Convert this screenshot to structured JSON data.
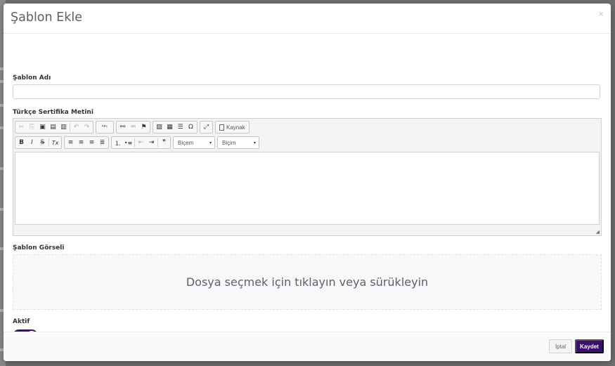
{
  "modal": {
    "title": "Şablon Ekle",
    "close_symbol": "×"
  },
  "fields": {
    "template_name_label": "Şablon Adı",
    "template_name_value": "",
    "certificate_text_label": "Türkçe Sertifika Metini",
    "template_image_label": "Şablon Görseli",
    "dropzone_text": "Dosya seçmek için tıklayın veya sürükleyin",
    "active_label": "Aktif",
    "active": true
  },
  "editor": {
    "source_label": "Kaynak",
    "format_combo_1": "Biçem",
    "format_combo_2": "Biçim",
    "icons": {
      "cut": "✂",
      "copy": "⎘",
      "paste": "▣",
      "paste_text": "▤",
      "paste_word": "▥",
      "undo": "↶",
      "redo": "↷",
      "spellcheck": "ᴬᴮᶜ",
      "link": "⚯",
      "unlink": "⚮",
      "anchor": "⚑",
      "image": "▨",
      "table": "▦",
      "hr": "☰",
      "special_char": "Ω",
      "maximize": "⤢",
      "bold": "B",
      "italic": "I",
      "strike": "S",
      "remove_format": "Tx",
      "align_left": "≡",
      "align_center": "≡",
      "align_right": "≡",
      "justify": "≣",
      "numbered_list": "⒈",
      "bulleted_list": "•≡",
      "outdent": "⇤",
      "indent": "⇥",
      "blockquote": "❞",
      "dropdown_arrow": "▾",
      "resize": "◢"
    }
  },
  "footer": {
    "cancel_label": "İptal",
    "save_label": "Kaydet"
  },
  "colors": {
    "primary": "#3b0f6d",
    "overlay": "#6f6f6f"
  }
}
